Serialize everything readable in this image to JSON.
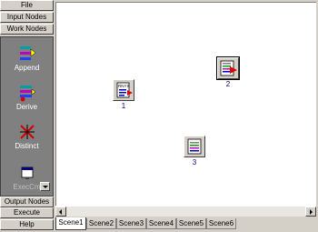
{
  "sidebar": {
    "file_label": "File",
    "input_nodes_label": "Input Nodes",
    "work_nodes_label": "Work Nodes",
    "output_nodes_label": "Output Nodes",
    "execute_label": "Execute",
    "help_label": "Help",
    "tools": [
      {
        "label": "Append",
        "icon": "append-icon"
      },
      {
        "label": "Derive",
        "icon": "derive-icon"
      },
      {
        "label": "Distinct",
        "icon": "distinct-icon"
      },
      {
        "label": "ExecCm",
        "icon": "execcmd-icon"
      }
    ]
  },
  "canvas": {
    "nodes": [
      {
        "label": "1",
        "icon": "read-node-icon"
      },
      {
        "label": "2",
        "icon": "write-node-icon"
      },
      {
        "label": "3",
        "icon": "document-node-icon"
      }
    ]
  },
  "tabs": [
    "Scene1",
    "Scene2",
    "Scene3",
    "Scene4",
    "Scene5",
    "Scene6"
  ],
  "colors": {
    "panel": "#d4d0c8",
    "tool_area": "#808080",
    "canvas": "#ffffff",
    "label": "#000080"
  }
}
